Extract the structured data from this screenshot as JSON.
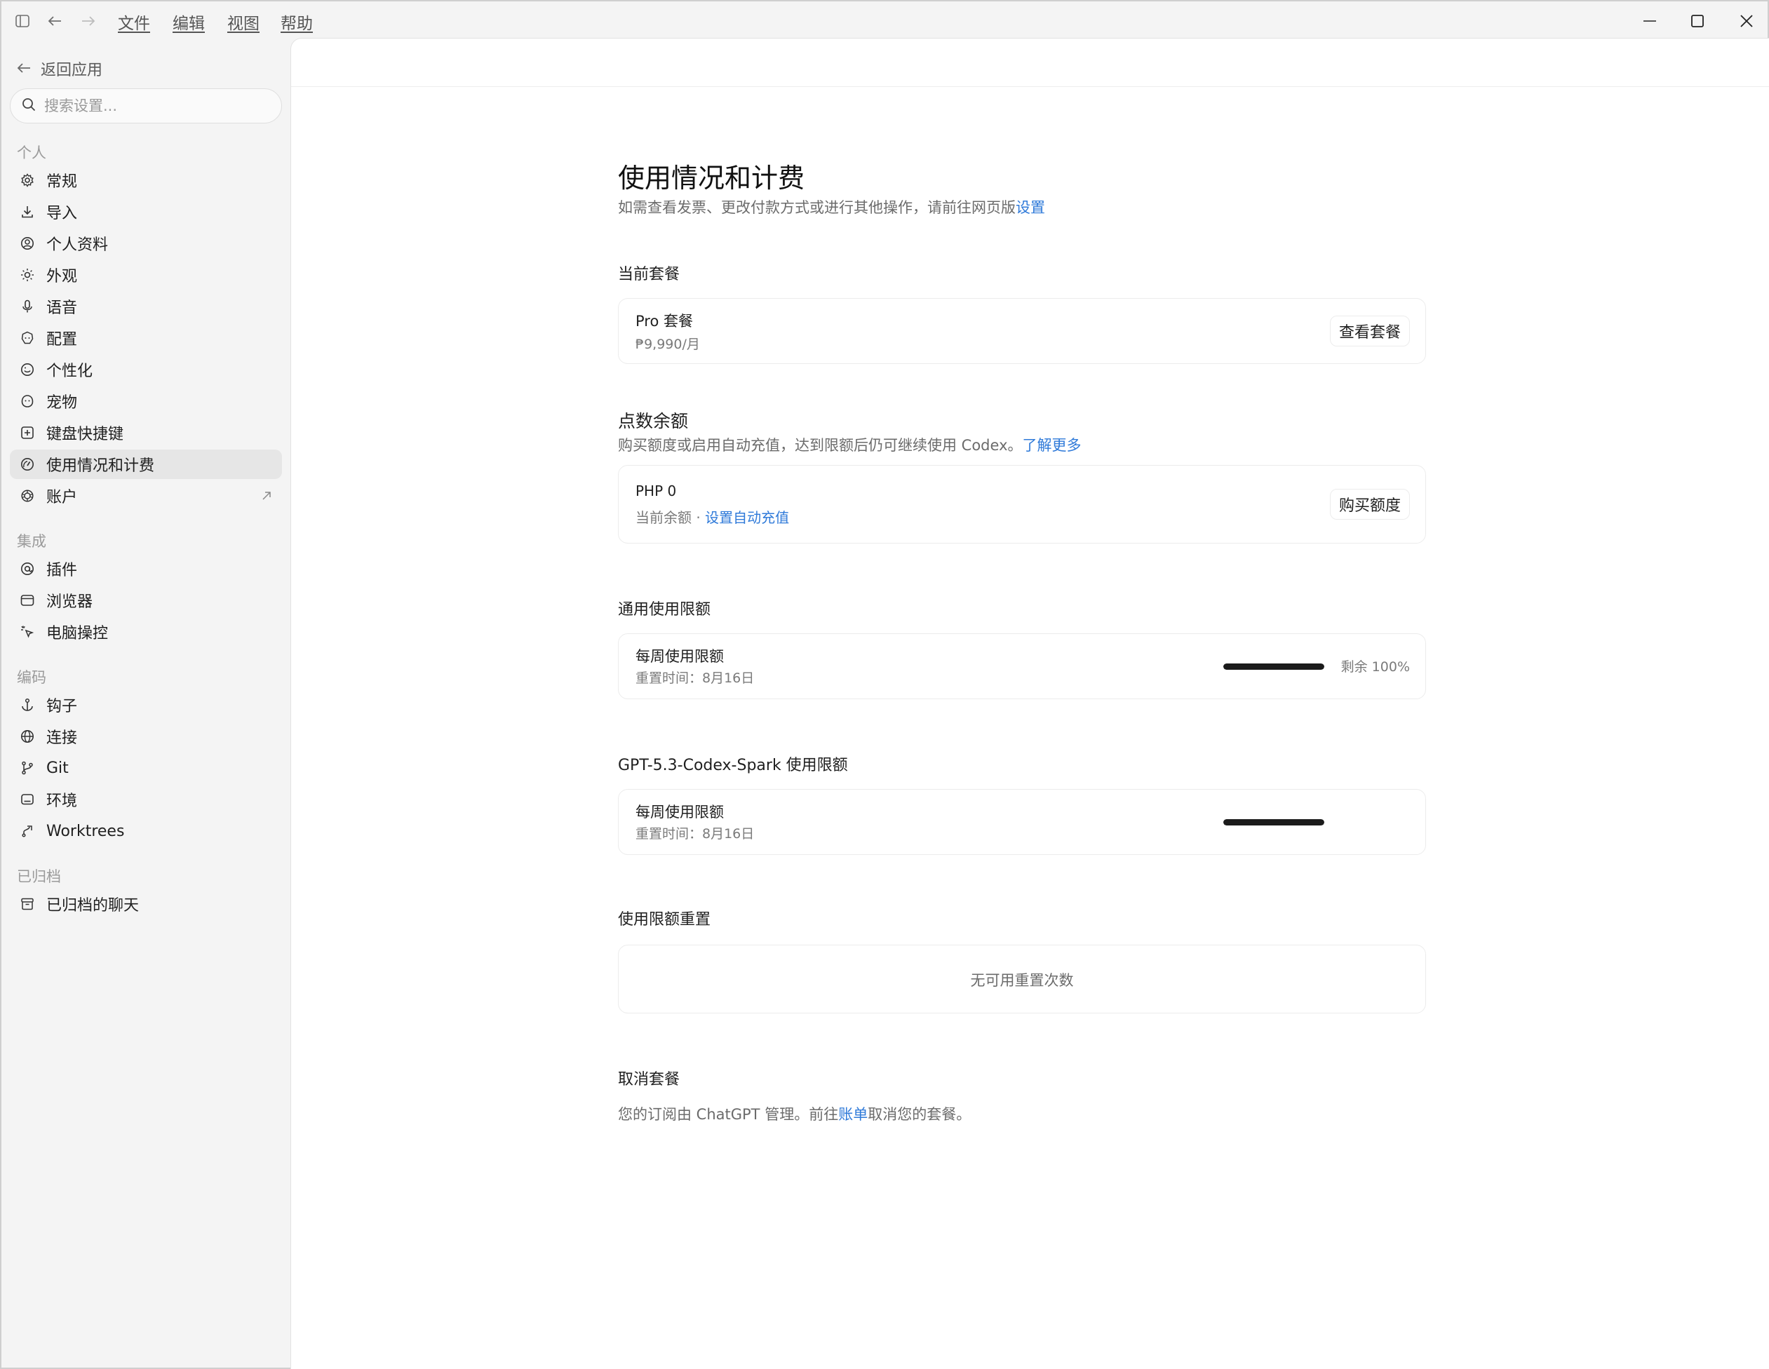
{
  "menu": {
    "file": "文件",
    "edit": "编辑",
    "view": "视图",
    "help": "帮助"
  },
  "sidebar": {
    "back_label": "返回应用",
    "search_placeholder": "搜索设置...",
    "sections": {
      "personal": "个人",
      "integrations": "集成",
      "coding": "编码",
      "archived": "已归档"
    },
    "items": {
      "general": "常规",
      "import": "导入",
      "profile": "个人资料",
      "appearance": "外观",
      "voice": "语音",
      "config": "配置",
      "personalization": "个性化",
      "pets": "宠物",
      "shortcuts": "键盘快捷键",
      "usage": "使用情况和计费",
      "account": "账户",
      "plugins": "插件",
      "browser": "浏览器",
      "computer_control": "电脑操控",
      "hooks": "钩子",
      "connections": "连接",
      "git": "Git",
      "environments": "环境",
      "worktrees": "Worktrees",
      "archived_chats": "已归档的聊天"
    }
  },
  "main": {
    "title": "使用情况和计费",
    "subtitle_prefix": "如需查看发票、更改付款方式或进行其他操作，请前往网页版",
    "subtitle_link": "设置",
    "current_plan": {
      "section": "当前套餐",
      "name": "Pro 套餐",
      "price": "₱9,990/月",
      "button": "查看套餐"
    },
    "credits": {
      "section": "点数余额",
      "desc_prefix": "购买额度或启用自动充值，达到限额后仍可继续使用 Codex。",
      "desc_link": "了解更多",
      "amount": "PHP 0",
      "balance_label": "当前余额 · ",
      "auto_topup_link": "设置自动充值",
      "button": "购买额度"
    },
    "general_limits": {
      "section": "通用使用限额",
      "label": "每周使用限额",
      "reset": "重置时间：8月16日",
      "remaining_percent": 100,
      "remaining_text": "剩余 100%"
    },
    "spark_limits": {
      "section": "GPT-5.3-Codex-Spark 使用限额",
      "label": "每周使用限额",
      "reset": "重置时间：8月16日",
      "remaining_percent": 100
    },
    "resets": {
      "section": "使用限额重置",
      "empty": "无可用重置次数"
    },
    "cancel": {
      "section": "取消套餐",
      "text_prefix": "您的订阅由 ChatGPT 管理。前往",
      "text_link": "账单",
      "text_suffix": "取消您的套餐。"
    }
  },
  "colors": {
    "accent": "#2f7ad9",
    "sidebar_bg": "#f4f4f4",
    "active_item_bg": "#e6e6e6",
    "bar_fill": "#1b1b1b"
  }
}
